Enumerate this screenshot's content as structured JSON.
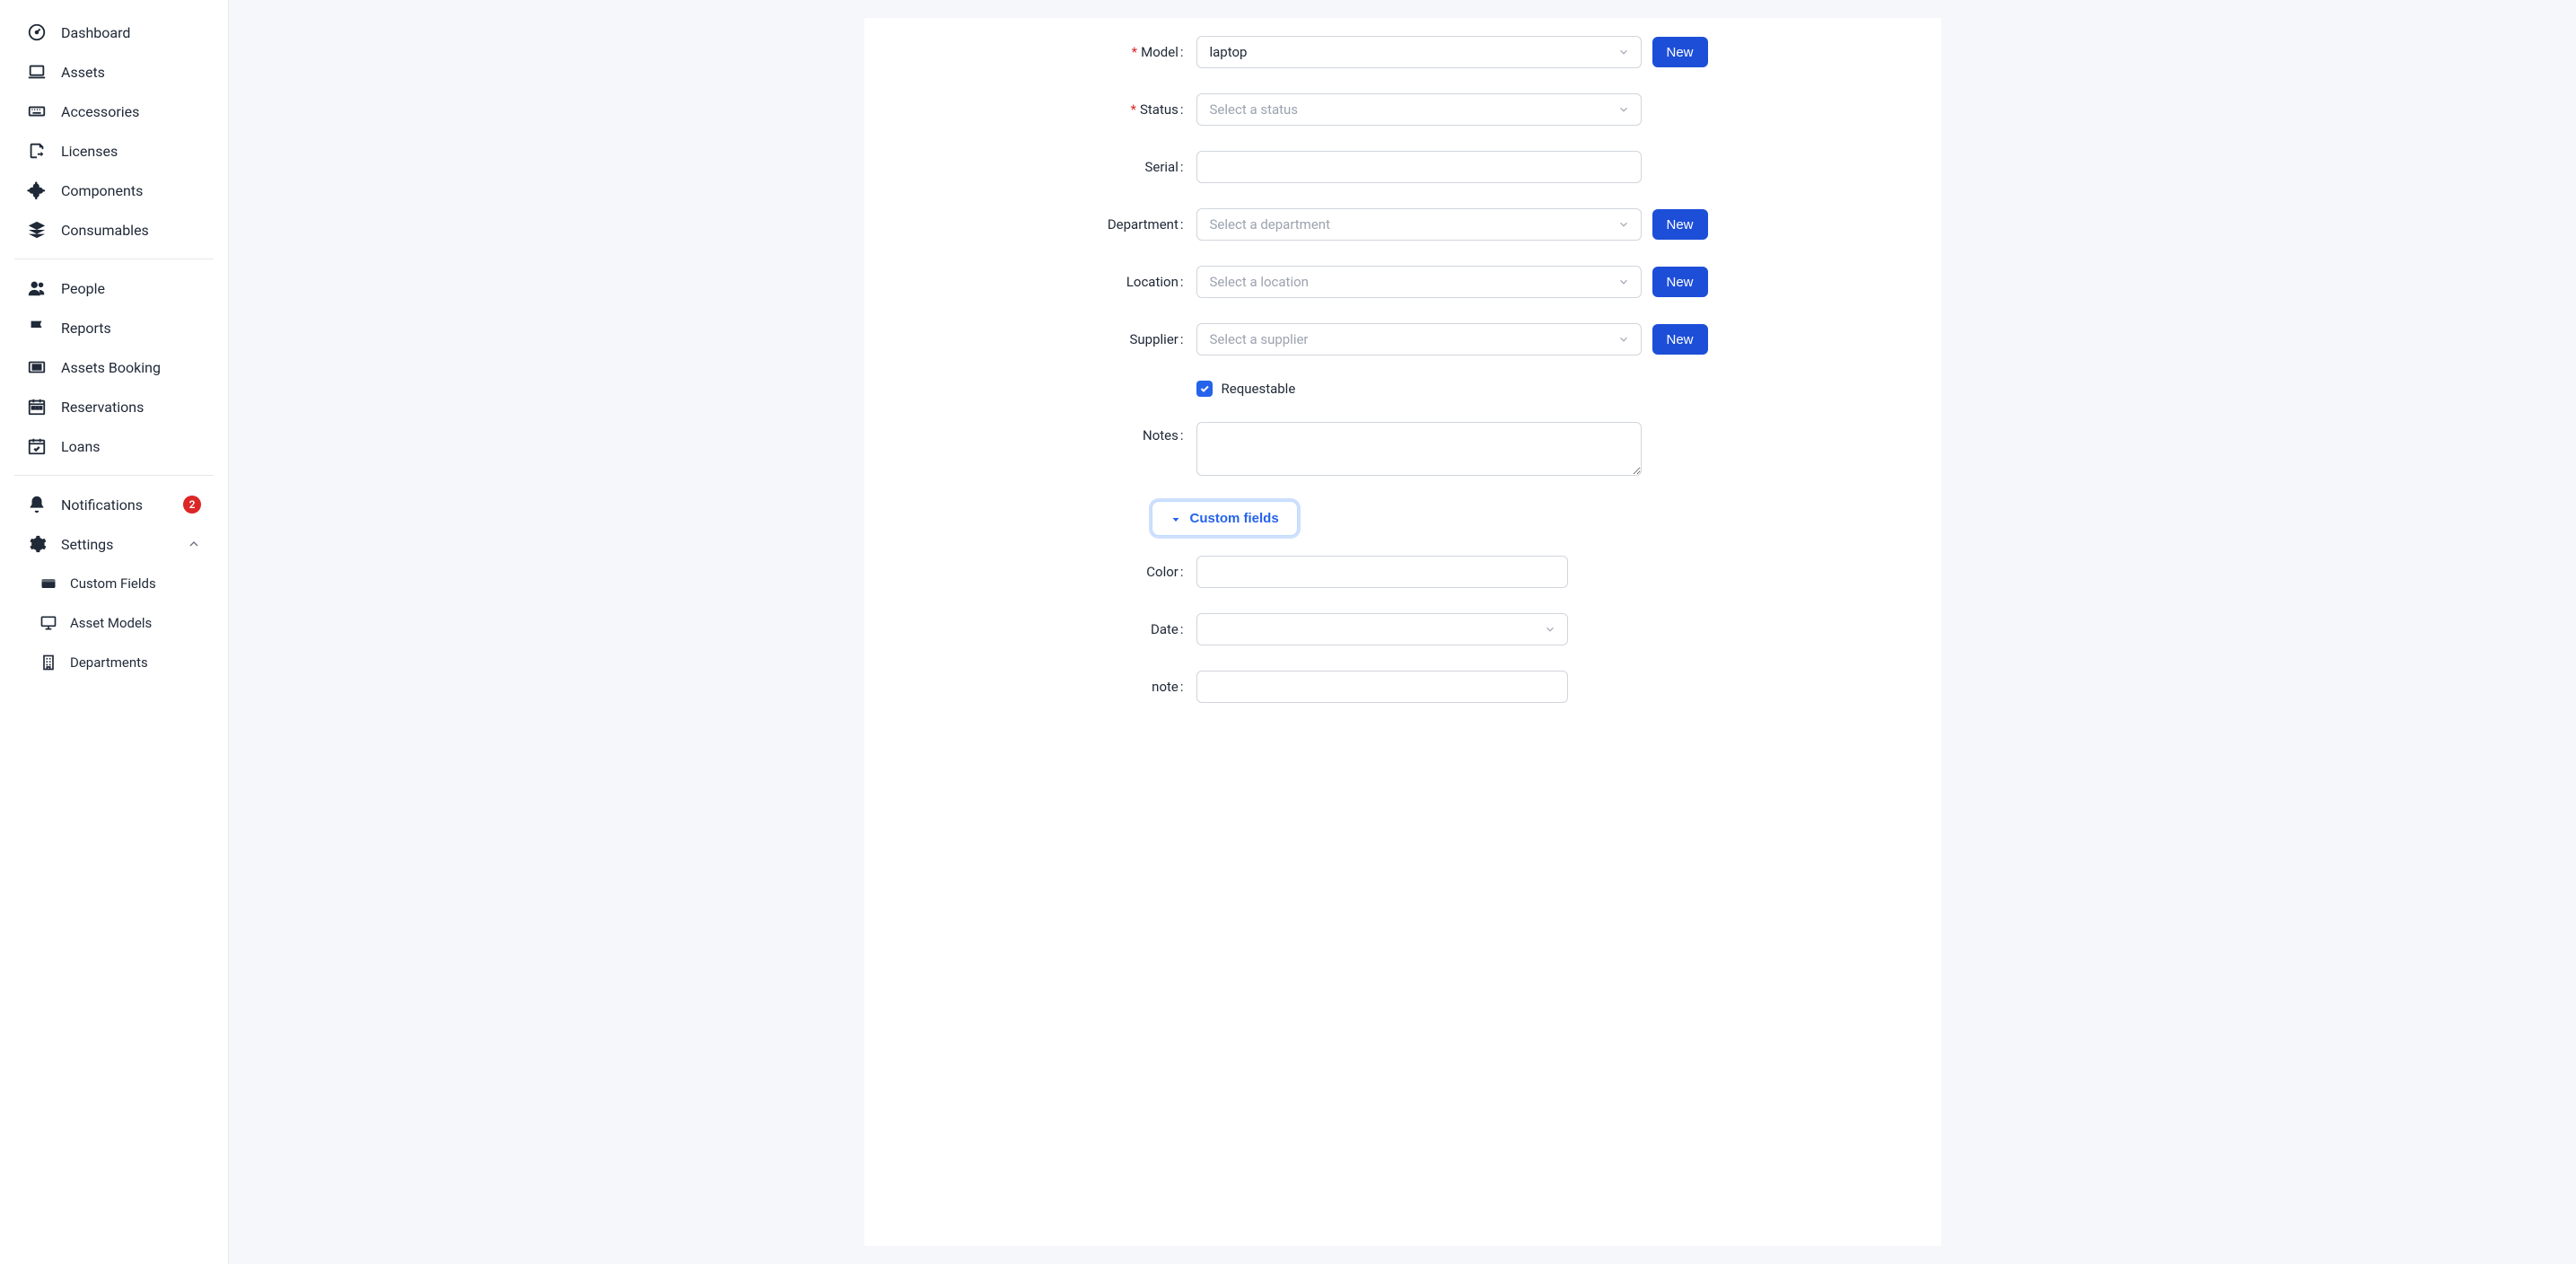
{
  "sidebar": {
    "items": [
      {
        "label": "Dashboard"
      },
      {
        "label": "Assets"
      },
      {
        "label": "Accessories"
      },
      {
        "label": "Licenses"
      },
      {
        "label": "Components"
      },
      {
        "label": "Consumables"
      }
    ],
    "items2": [
      {
        "label": "People"
      },
      {
        "label": "Reports"
      },
      {
        "label": "Assets Booking"
      },
      {
        "label": "Reservations"
      },
      {
        "label": "Loans"
      }
    ],
    "notifications_label": "Notifications",
    "notifications_badge": "2",
    "settings_label": "Settings",
    "settings_children": [
      {
        "label": "Custom Fields"
      },
      {
        "label": "Asset Models"
      },
      {
        "label": "Departments"
      }
    ]
  },
  "form": {
    "model": {
      "label": "Model",
      "value": "laptop",
      "new_btn": "New"
    },
    "status": {
      "label": "Status",
      "placeholder": "Select a status"
    },
    "serial": {
      "label": "Serial",
      "value": ""
    },
    "department": {
      "label": "Department",
      "placeholder": "Select a department",
      "new_btn": "New"
    },
    "location": {
      "label": "Location",
      "placeholder": "Select a location",
      "new_btn": "New"
    },
    "supplier": {
      "label": "Supplier",
      "placeholder": "Select a supplier",
      "new_btn": "New"
    },
    "requestable_label": "Requestable",
    "notes": {
      "label": "Notes",
      "value": ""
    },
    "custom_fields_btn": "Custom fields",
    "color": {
      "label": "Color",
      "value": ""
    },
    "date": {
      "label": "Date",
      "value": ""
    },
    "note": {
      "label": "note",
      "value": ""
    }
  }
}
